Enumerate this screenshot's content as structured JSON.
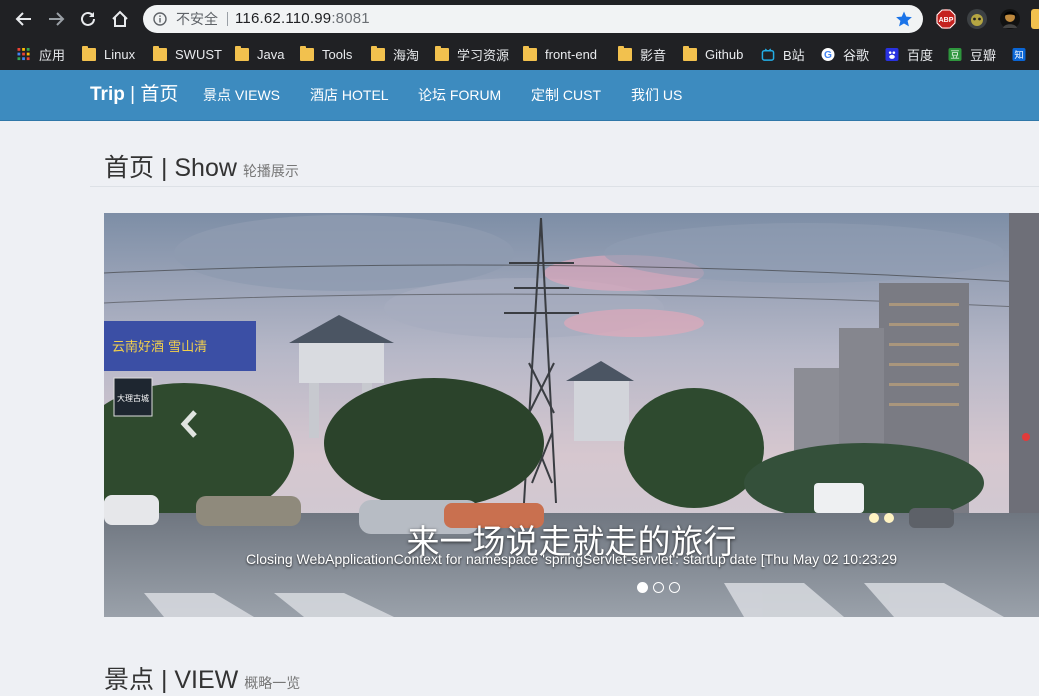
{
  "browser": {
    "security_label": "不安全",
    "url_host": "116.62.110.99",
    "url_port": ":8081",
    "extensions": [
      "abp-icon",
      "tampermonkey-icon",
      "profile-avatar-icon",
      "extension-icon"
    ],
    "bookmarks": [
      {
        "label": "应用",
        "icon": "apps-grid-icon"
      },
      {
        "label": "Linux",
        "icon": "folder-icon"
      },
      {
        "label": "SWUST",
        "icon": "folder-icon"
      },
      {
        "label": "Java",
        "icon": "folder-icon"
      },
      {
        "label": "Tools",
        "icon": "folder-icon"
      },
      {
        "label": "海淘",
        "icon": "folder-icon"
      },
      {
        "label": "学习资源",
        "icon": "folder-icon"
      },
      {
        "label": "front-end",
        "icon": "folder-icon"
      },
      {
        "label": "影音",
        "icon": "folder-icon"
      },
      {
        "label": "Github",
        "icon": "folder-icon"
      },
      {
        "label": "B站",
        "icon": "bilibili-icon"
      },
      {
        "label": "谷歌",
        "icon": "google-icon"
      },
      {
        "label": "百度",
        "icon": "baidu-icon"
      },
      {
        "label": "豆瓣",
        "icon": "douban-icon"
      },
      {
        "label": "知",
        "icon": "zhihu-icon"
      }
    ],
    "colors": {
      "chrome": "#202124",
      "omnibox": "#f1f3f4",
      "star": "#1a73e8",
      "folder": "#f2c14e"
    }
  },
  "site": {
    "brand_main": "Trip",
    "brand_sep": " | ",
    "brand_sub": "首页",
    "nav": [
      "景点 VIEWS",
      "酒店 HOTEL",
      "论坛 FORUM",
      "定制 CUST",
      "我们 US"
    ],
    "nav_color": "#3d8bbf"
  },
  "show_section": {
    "title": "首页 | Show",
    "subtitle": "轮播展示"
  },
  "carousel": {
    "caption_title": "来一场说走就走的旅行",
    "caption_text": "Closing WebApplicationContext for namespace 'springServlet-servlet': startup date [Thu May 02 10:23:29",
    "indicator_count": 3,
    "active_index": 0,
    "billboard_text": "云南好酒 雪山清",
    "sign_text": "大理古城"
  },
  "view_section": {
    "title": "景点 | VIEW",
    "subtitle": "概略一览"
  }
}
